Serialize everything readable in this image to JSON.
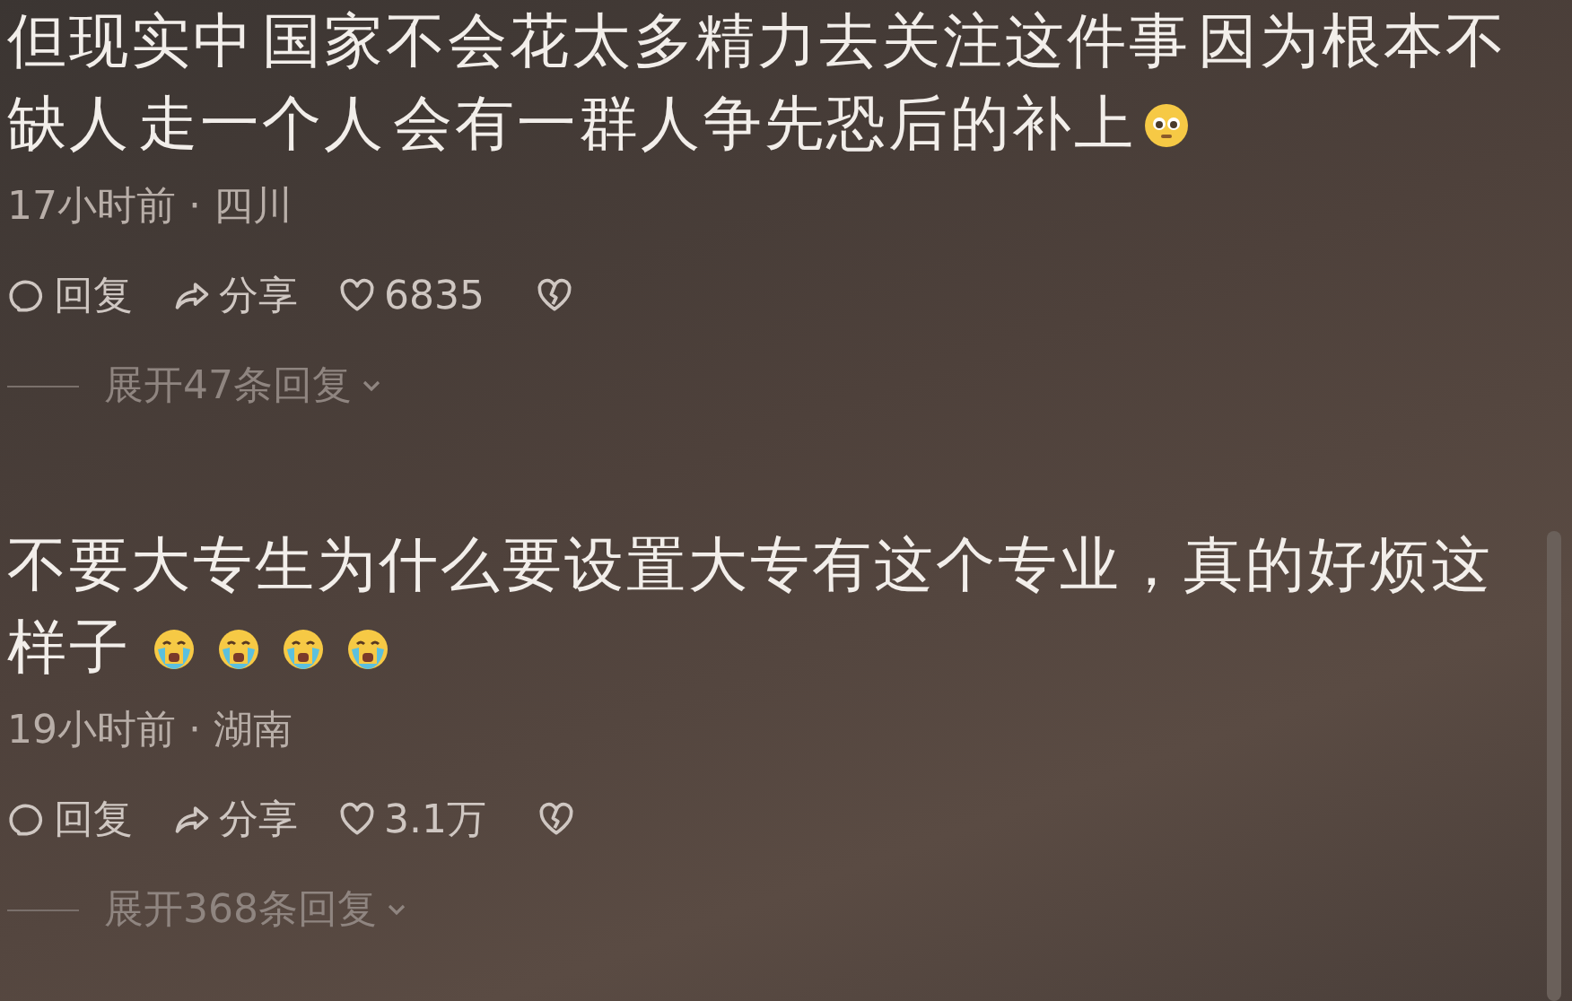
{
  "comments": [
    {
      "text": "但现实中 国家不会花太多精力去关注这件事 因为根本不缺人 走一个人 会有一群人争先恐后的补上",
      "emojis": [
        {
          "kind": "teary"
        }
      ],
      "meta": "17小时前 · 四川",
      "reply": "回复",
      "share": "分享",
      "likes": "6835",
      "expand": "展开47条回复"
    },
    {
      "text": "不要大专生为什么要设置大专有这个专业，真的好烦这样子",
      "emojis": [
        {
          "kind": "crying"
        },
        {
          "kind": "crying"
        },
        {
          "kind": "crying"
        },
        {
          "kind": "crying"
        }
      ],
      "meta": "19小时前 · 湖南",
      "reply": "回复",
      "share": "分享",
      "likes": "3.1万",
      "expand": "展开368条回复"
    }
  ]
}
